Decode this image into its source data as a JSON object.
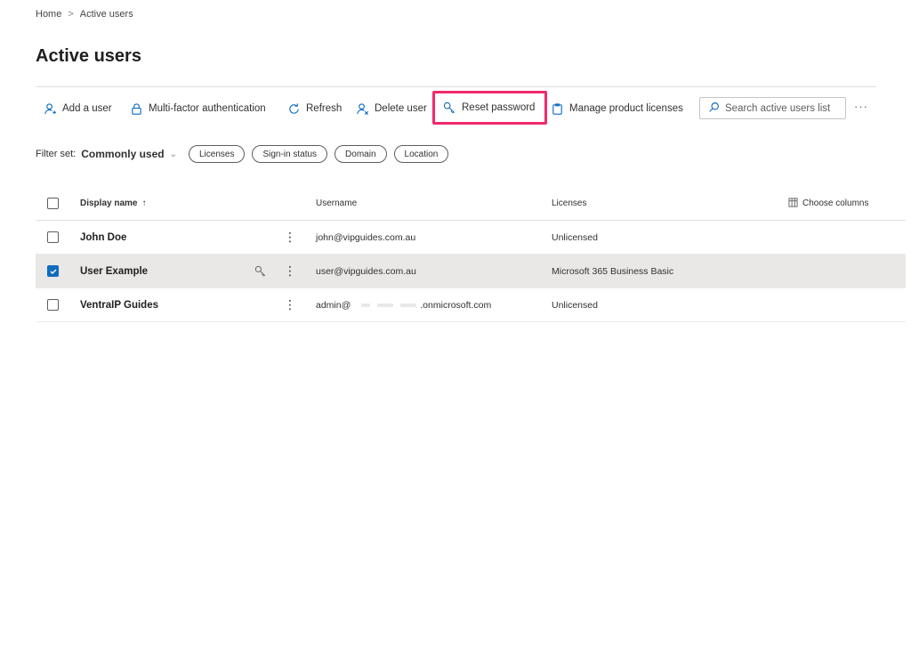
{
  "breadcrumb": {
    "home": "Home",
    "separator": ">",
    "current": "Active users"
  },
  "page": {
    "title": "Active users"
  },
  "toolbar": {
    "add_user": "Add a user",
    "mfa": "Multi-factor authentication",
    "refresh": "Refresh",
    "delete_user": "Delete user",
    "reset_password": "Reset password",
    "manage_licenses": "Manage product licenses",
    "search_placeholder": "Search active users list",
    "more": "···"
  },
  "filters": {
    "label": "Filter set:",
    "value": "Commonly used",
    "pills": [
      "Licenses",
      "Sign-in status",
      "Domain",
      "Location"
    ]
  },
  "table": {
    "columns": {
      "display_name": "Display name",
      "sort_indicator": "↑",
      "username": "Username",
      "licenses": "Licenses",
      "choose_columns": "Choose columns"
    },
    "rows": [
      {
        "name": "John Doe",
        "username": "john@vipguides.com.au",
        "license": "Unlicensed",
        "selected": false
      },
      {
        "name": "User Example",
        "username": "user@vipguides.com.au",
        "license": "Microsoft 365 Business Basic",
        "selected": true
      },
      {
        "name": "VentraIP Guides",
        "username_prefix": "admin@",
        "username_suffix": ".onmicrosoft.com",
        "license": "Unlicensed",
        "selected": false
      }
    ]
  },
  "colors": {
    "accent": "#0f6cbd",
    "highlight": "#f02a6b",
    "selected_row": "#e9e8e7"
  },
  "icons": [
    "add-user-icon",
    "lock-icon",
    "refresh-icon",
    "delete-user-icon",
    "key-icon",
    "clipboard-icon",
    "search-icon",
    "choose-columns-icon",
    "checkmark-icon"
  ]
}
